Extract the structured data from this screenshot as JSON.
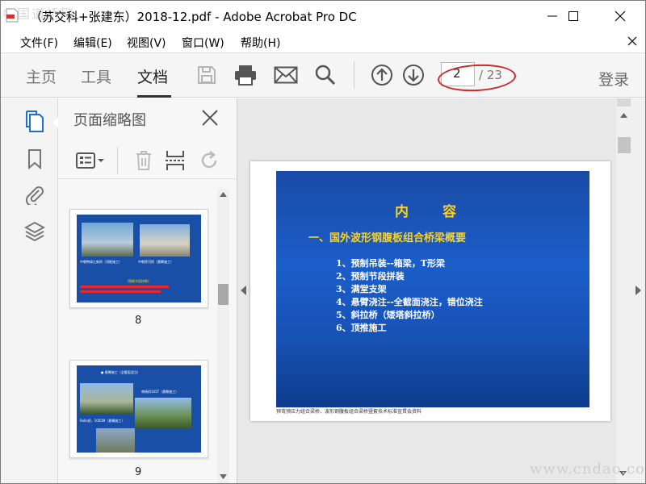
{
  "window": {
    "title": "（苏交科+张建东）2018-12.pdf - Adobe Acrobat Pro DC",
    "watermark_top": "中国道桥网",
    "watermark_bottom": "www.cndao.com"
  },
  "menu": {
    "items": [
      "文件(F)",
      "编辑(E)",
      "视图(V)",
      "窗口(W)",
      "帮助(H)"
    ]
  },
  "toolbar": {
    "tabs": [
      "主页",
      "工具",
      "文档"
    ],
    "active_tab": "文档",
    "page_current": "2",
    "page_total": "/ 23",
    "login": "登录"
  },
  "thumbnails_panel": {
    "title": "页面缩略图",
    "pages": [
      {
        "number": "8",
        "caption_lines": [
          "中朝鸭绿江新桥（顶推施工）",
          "中朝界河桥（悬臂施工）",
          "（预制节段拼装）"
        ]
      },
      {
        "number": "9",
        "caption_lines": [
          "● 悬臂施工（全截面浇注）",
          "串杨桥105T（悬臂施工）",
          "Rollo桥，1005M（悬臂施工）"
        ]
      }
    ]
  },
  "document": {
    "slide_title": "内 容",
    "slide_subtitle": "一、国外波形钢腹板组合桥梁概要",
    "items": [
      "1、预制吊装--箱梁，T形梁",
      "2、预制节段拼装",
      "3、满堂支架",
      "4、悬臂浇注--全截面浇注，错位浇注",
      "5、斜拉桥（矮塔斜拉桥）",
      "6、顶推施工"
    ],
    "footer_note": "预弯预应力组合梁桥、波形钢腹板组合梁桥暨套技术标准宣贯会资料"
  },
  "colors": {
    "accent_red": "#cc2a2a",
    "slide_blue": "#1b5ec9",
    "slide_yellow": "#ffd21a"
  }
}
